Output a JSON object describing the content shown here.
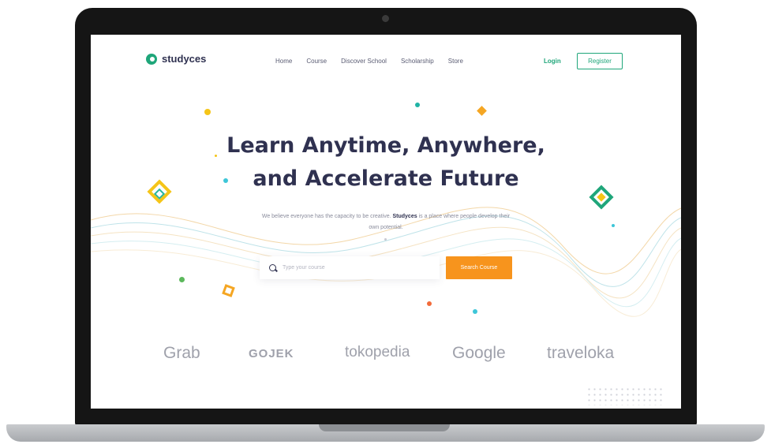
{
  "nav": {
    "logo_text": "studyces",
    "links": [
      "Home",
      "Course",
      "Discover School",
      "Scholarship",
      "Store"
    ],
    "login_label": "Login",
    "register_label": "Register"
  },
  "hero": {
    "title_line1": "Learn Anytime, Anywhere,",
    "title_line2": "and Accelerate Future",
    "subtitle_prefix": "We believe everyone has the capacity to be creative.",
    "subtitle_brand": "Studyces",
    "subtitle_suffix": "is a place where people develop their own potential."
  },
  "search": {
    "placeholder": "Type your course",
    "button_label": "Search Course"
  },
  "brands": [
    "Grab",
    "GOJEK",
    "tokopedia",
    "Google",
    "traveloka"
  ],
  "colors": {
    "primary": "#1fa67a",
    "accent": "#f7941d",
    "heading": "#2f3150",
    "yellow": "#f5c518",
    "cyan": "#3ec6d8"
  }
}
